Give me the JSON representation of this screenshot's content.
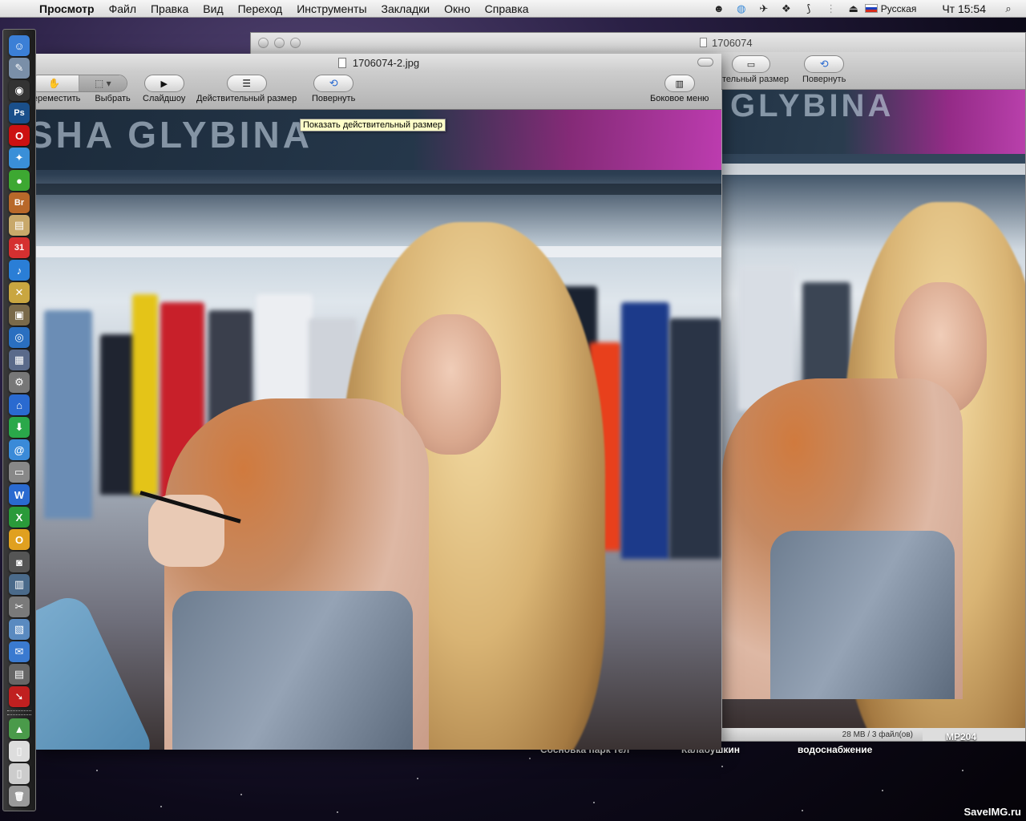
{
  "menubar": {
    "apple_icon": "apple-icon",
    "app_name": "Просмотр",
    "items": [
      "Файл",
      "Правка",
      "Вид",
      "Переход",
      "Инструменты",
      "Закладки",
      "Окно",
      "Справка"
    ],
    "language": "Русская",
    "clock": "Чт 15:54",
    "tray_icons": [
      "alien-icon",
      "globe-icon",
      "bird-icon",
      "paw-icon",
      "vector-icon",
      "grip-icon",
      "eject-icon"
    ]
  },
  "dock": {
    "icons": [
      {
        "name": "finder-icon",
        "glyph": "☺",
        "color": "#3b7fd6"
      },
      {
        "name": "preview-icon",
        "glyph": "✎",
        "color": "#7a8fa8"
      },
      {
        "name": "dashboard-icon",
        "glyph": "◉",
        "color": "#333"
      },
      {
        "name": "photoshop-icon",
        "glyph": "Ps",
        "color": "#1a4f8a"
      },
      {
        "name": "opera-icon",
        "glyph": "O",
        "color": "#cc1111"
      },
      {
        "name": "safari-icon",
        "glyph": "✦",
        "color": "#3a8fd8"
      },
      {
        "name": "adium-icon",
        "glyph": "●",
        "color": "#3da832"
      },
      {
        "name": "bridge-icon",
        "glyph": "Br",
        "color": "#b8682a"
      },
      {
        "name": "notebook-icon",
        "glyph": "▤",
        "color": "#c8a86a"
      },
      {
        "name": "ical-icon",
        "glyph": "31",
        "color": "#d53030"
      },
      {
        "name": "itunes-icon",
        "glyph": "♪",
        "color": "#2a7ed6"
      },
      {
        "name": "tool-icon",
        "glyph": "✕",
        "color": "#c9a640"
      },
      {
        "name": "iphoto-icon",
        "glyph": "▣",
        "color": "#7a6a4a"
      },
      {
        "name": "dvd-icon",
        "glyph": "◎",
        "color": "#2a6fc0"
      },
      {
        "name": "spaces-icon",
        "glyph": "▦",
        "color": "#5a6a8a"
      },
      {
        "name": "system-preferences-icon",
        "glyph": "⚙",
        "color": "#777"
      },
      {
        "name": "home-icon",
        "glyph": "⌂",
        "color": "#2a6ad0"
      },
      {
        "name": "download-icon",
        "glyph": "⬇",
        "color": "#2aa84a"
      },
      {
        "name": "address-icon",
        "glyph": "@",
        "color": "#3a8ad8"
      },
      {
        "name": "printer-icon",
        "glyph": "▭",
        "color": "#888"
      },
      {
        "name": "word-icon",
        "glyph": "W",
        "color": "#2a6ad0"
      },
      {
        "name": "excel-icon",
        "glyph": "X",
        "color": "#2a9a3a"
      },
      {
        "name": "office-icon",
        "glyph": "O",
        "color": "#e0a020"
      },
      {
        "name": "photo-booth-icon",
        "glyph": "◙",
        "color": "#555"
      },
      {
        "name": "network-icon",
        "glyph": "▥",
        "color": "#4a6a8a"
      },
      {
        "name": "utility-icon",
        "glyph": "✂",
        "color": "#7a7a7a"
      },
      {
        "name": "image-capture-icon",
        "glyph": "▧",
        "color": "#5a8ac0"
      },
      {
        "name": "mail-icon",
        "glyph": "✉",
        "color": "#3a7ad0"
      },
      {
        "name": "archive-icon",
        "glyph": "▤",
        "color": "#666"
      },
      {
        "name": "arrow-icon",
        "glyph": "➘",
        "color": "#c02020"
      }
    ],
    "bottom_icons": [
      {
        "name": "applications-stack-icon",
        "glyph": "▲",
        "color": "#4a9a4a"
      },
      {
        "name": "document-icon",
        "glyph": "▯",
        "color": "#ddd"
      },
      {
        "name": "documents-stack-icon",
        "glyph": "▯",
        "color": "#ccc"
      },
      {
        "name": "trash-icon",
        "glyph": "🗑",
        "color": "#9a9a9a"
      }
    ]
  },
  "back_window": {
    "title": "1706074",
    "toolbar": {
      "actual_size_label": "тельный размер",
      "rotate_label": "Повернуть"
    },
    "status": "28 MB / 3 файл(ов)"
  },
  "front_window": {
    "title": "1706074-2.jpg",
    "toolbar": {
      "move_label": "Переместить",
      "select_label": "Выбрать",
      "slideshow_label": "Слайдшоу",
      "actual_size_label": "Действительный размер",
      "rotate_label": "Повернуть",
      "sidebar_label": "Боковое меню"
    },
    "tooltip": "Показать действительный размер"
  },
  "photo": {
    "banner_text": "SHA GLYBINA",
    "back_banner_text": "GLYBINA"
  },
  "desktop_labels": [
    "Сосновка парк тел",
    "Калабушкин",
    "водоснабжение",
    "MP204"
  ],
  "watermark": "SaveIMG.ru"
}
